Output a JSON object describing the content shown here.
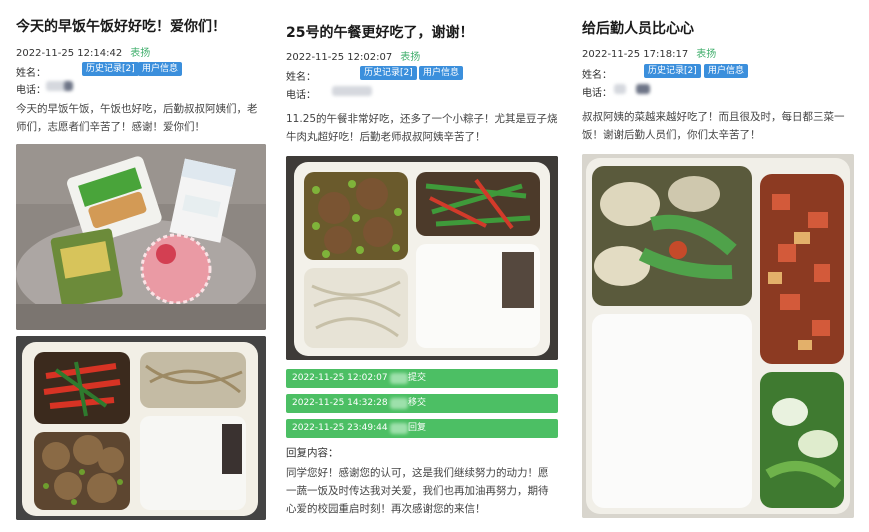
{
  "cards": [
    {
      "title": "今天的早饭午饭好好吃！爱你们！",
      "datetime": "2022-11-25 12:14:42",
      "badge": "表扬",
      "name_label": "姓名：",
      "phone_label": "电话：",
      "history_btn": "历史记录[2]",
      "userinfo_btn": "用户信息",
      "body": "今天的早饭午饭，午饭也好吃，后勤叔叔阿姨们，老师们，志愿者们辛苦了！感谢！爱你们！",
      "photos": [
        "breakfast-photo",
        "lunch-box-photo"
      ]
    },
    {
      "title": "25号的午餐更好吃了，谢谢！",
      "datetime": "2022-11-25 12:02:07",
      "badge": "表扬",
      "name_label": "姓名：",
      "phone_label": "电话：",
      "history_btn": "历史记录[2]",
      "userinfo_btn": "用户信息",
      "body": "11.25的午餐非常好吃，还多了一个小粽子！尤其是豆子烧牛肉丸超好吃！后勤老师叔叔阿姨辛苦了！",
      "photos": [
        "lunch-box-photo"
      ],
      "replies": [
        {
          "time": "2022-11-25 12:02:07",
          "text": "提交"
        },
        {
          "time": "2022-11-25 14:32:28",
          "text": "移交"
        },
        {
          "time": "2022-11-25 23:49:44",
          "text": "回复"
        }
      ],
      "reply_label": "回复内容：",
      "reply_body": "同学您好！感谢您的认可，这是我们继续努力的动力！愿一蔬一饭及时传达我对关爱，我们也再加油再努力，期待心爱的校园重启时刻！再次感谢您的来信！"
    },
    {
      "title": "给后勤人员比心心",
      "datetime": "2022-11-25 17:18:17",
      "badge": "表扬",
      "name_label": "姓名：",
      "phone_label": "电话：",
      "history_btn": "历史记录[2]",
      "userinfo_btn": "用户信息",
      "body": "叔叔阿姨的菜越来越好吃了！而且很及时，每日都三菜一饭！谢谢后勤人员们，你们太辛苦了！",
      "photos": [
        "lunch-box-photo"
      ]
    }
  ]
}
